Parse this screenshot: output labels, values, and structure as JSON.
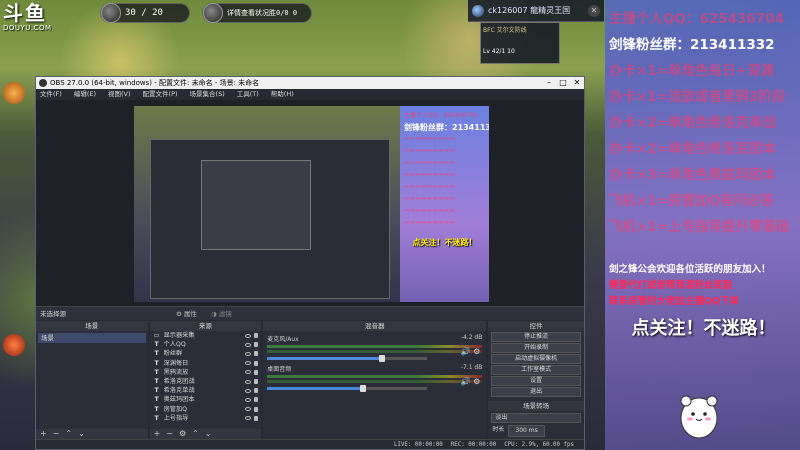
{
  "stream": {
    "logo_text": "斗鱼",
    "logo_sub": "DOUYU.COM",
    "hud_energy": "30 / 20",
    "hud_quest": "详情查看状况胜0/0 0",
    "char_name": "ck126007 龍精灵王国",
    "char_panel_title": "BFC 艾尔文防线",
    "char_level": "Lv 42/1 10"
  },
  "overlay": {
    "lines": [
      {
        "text": "主播个人QQ：625436704",
        "color": "#ff3a6a",
        "faded": true
      },
      {
        "text": "剑锋粉丝群：213411332",
        "color": "#ffffff",
        "faded": false
      },
      {
        "text": "办卡×1=单角色每日+深渊",
        "color": "#ff3a6a",
        "faded": true
      },
      {
        "text": "办卡×1=流放或者黑鸦3阶段",
        "color": "#ff3a6a",
        "faded": true
      },
      {
        "text": "办卡×2=单角色希洛克单战",
        "color": "#ff3a6a",
        "faded": true
      },
      {
        "text": "办卡×2=单角色希洛克团本",
        "color": "#ff3a6a",
        "faded": true
      },
      {
        "text": "办卡×3=单角色奥兹玛团本",
        "color": "#ff3a6a",
        "faded": true
      },
      {
        "text": "飞机×1=房管加Q有问必答",
        "color": "#ff3a6a",
        "faded": true
      },
      {
        "text": "飞机×1=上号指导提升零基础",
        "color": "#ff3a6a",
        "faded": true
      }
    ],
    "notice_white": "剑之锋公会欢迎各位活跃的朋友加入！",
    "notice_red1": "需要代打或者帮我混粉丝奖励",
    "notice_red2": "联系房管的大佬加主播QQ下单",
    "follow": "点关注！不迷路！"
  },
  "obs": {
    "title": "OBS 27.0.0 (64-bit, windows) - 配置文件: 未命名 - 场景: 未命名",
    "menu": [
      "文件(F)",
      "编辑(E)",
      "视图(V)",
      "配置文件(P)",
      "场景集合(S)",
      "工具(T)",
      "帮助(H)"
    ],
    "preview_right": {
      "qq_line": "主播个人QQ：625436704",
      "group_line": "剑锋粉丝群：213411332",
      "follow": "点关注！不迷路！"
    },
    "no_source": "未选择源",
    "properties": "属性",
    "filters": "滤镜",
    "scenes_title": "场景",
    "scene_selected": "场景",
    "sources_title": "来源",
    "sources": [
      {
        "type": "display",
        "name": "显示器采集"
      },
      {
        "type": "text",
        "name": "个人QQ"
      },
      {
        "type": "text",
        "name": "粉丝群"
      },
      {
        "type": "text",
        "name": "深渊每日"
      },
      {
        "type": "text",
        "name": "黑鸦流放"
      },
      {
        "type": "text",
        "name": "希洛克团战"
      },
      {
        "type": "text",
        "name": "希洛克单战"
      },
      {
        "type": "text",
        "name": "奥兹玛团本"
      },
      {
        "type": "text",
        "name": "房管加Q"
      },
      {
        "type": "text",
        "name": "上号指导"
      }
    ],
    "mixer_title": "混音器",
    "mixer": [
      {
        "name": "麦克风/Aux",
        "db": "-4.2 dB",
        "volume": 0.72
      },
      {
        "name": "桌面音频",
        "db": "-7.1 dB",
        "volume": 0.6
      }
    ],
    "controls_title": "控件",
    "controls": [
      "停止推流",
      "开始录制",
      "启动虚拟摄像机",
      "工作室模式",
      "设置",
      "退出"
    ],
    "transitions_title": "场景转场",
    "transition": "淡出",
    "duration_label": "时长",
    "duration_value": "300 ms",
    "status": {
      "live": "LIVE: 00:00:00",
      "rec": "REC: 00:00:00",
      "cpu": "CPU: 2.9%, 60.00 fps"
    }
  }
}
